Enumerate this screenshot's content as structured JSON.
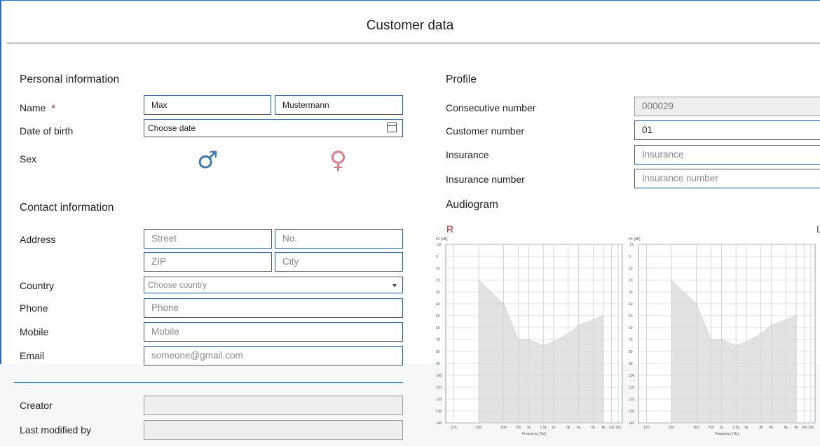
{
  "window": {
    "title": "Customer data"
  },
  "personal": {
    "heading": "Personal information",
    "name_label": "Name",
    "required_marker": "*",
    "first_name": "Max",
    "last_name": "Mustermann",
    "dob_label": "Date of birth",
    "dob_value": "Choose date",
    "sex_label": "Sex",
    "male_symbol": "♂",
    "female_symbol": "♀"
  },
  "contact": {
    "heading": "Contact information",
    "address_label": "Address",
    "street_placeholder": "Street",
    "number_placeholder": "No.",
    "zip_placeholder": "ZIP",
    "city_placeholder": "City",
    "country_label": "Country",
    "country_value": "Choose country",
    "phone_label": "Phone",
    "phone_placeholder": "Phone",
    "mobile_label": "Mobile",
    "mobile_placeholder": "Mobile",
    "email_label": "Email",
    "email_placeholder": "someone@gmail.com"
  },
  "meta": {
    "creator_label": "Creator",
    "creator_value": "",
    "modified_label": "Last modified by",
    "modified_value": ""
  },
  "profile": {
    "heading": "Profile",
    "consecutive_label": "Consecutive number",
    "consecutive_value": "000029",
    "customer_label": "Customer number",
    "customer_value": "01",
    "insurance_label": "Insurance",
    "insurance_placeholder": "Insurance",
    "insurance_number_label": "Insurance number",
    "insurance_number_placeholder": "Insurance number"
  },
  "audiogram": {
    "heading": "Audiogram",
    "right_ear_label": "R",
    "left_ear_label": "L",
    "y_axis_label": "HL [dB]",
    "x_axis_label": "Frequency [Hz]",
    "y_ticks": [
      "-10",
      "0",
      "10",
      "20",
      "30",
      "40",
      "50",
      "60",
      "70",
      "80",
      "90",
      "100",
      "110",
      "120",
      "130",
      "140"
    ],
    "x_ticks": [
      "125",
      "250",
      "500",
      "750",
      "1k",
      "1.5k",
      "2k",
      "3k",
      "4k",
      "6k",
      "8k",
      "10k",
      "12k"
    ],
    "colors": {
      "right": "#e02020",
      "male": "#3a78b5",
      "female": "#e07a85",
      "fill": "#d8d8d8"
    }
  },
  "chart_data": [
    {
      "type": "area",
      "title": "R",
      "xlabel": "Frequency [Hz]",
      "ylabel": "HL [dB]",
      "ylim": [
        -10,
        140
      ],
      "y_inverted": true,
      "x": [
        250,
        500,
        750,
        1000,
        1500,
        2000,
        3000,
        4000,
        8000
      ],
      "values": [
        20,
        40,
        70,
        70,
        75,
        72,
        65,
        58,
        50
      ]
    },
    {
      "type": "area",
      "title": "L",
      "xlabel": "Frequency [Hz]",
      "ylabel": "HL [dB]",
      "ylim": [
        -10,
        140
      ],
      "y_inverted": true,
      "x": [
        250,
        500,
        750,
        1000,
        1500,
        2000,
        3000,
        4000,
        8000
      ],
      "values": [
        20,
        40,
        70,
        70,
        75,
        72,
        65,
        58,
        50
      ]
    }
  ]
}
